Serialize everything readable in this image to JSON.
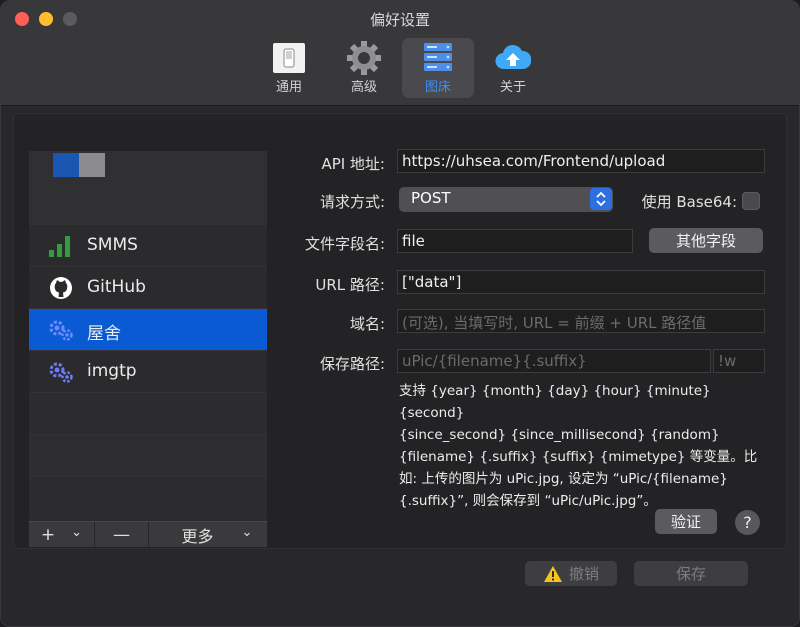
{
  "window": {
    "title": "偏好设置"
  },
  "toolbar": {
    "items": [
      {
        "label": "通用"
      },
      {
        "label": "高级"
      },
      {
        "label": "图床"
      },
      {
        "label": "关于"
      }
    ]
  },
  "hosts": {
    "items": [
      {
        "label": "SMMS"
      },
      {
        "label": "GitHub"
      },
      {
        "label": "屋舍"
      },
      {
        "label": "imgtp"
      }
    ],
    "actions": {
      "add": "+",
      "add_more": "⌄",
      "remove": "—",
      "more": "更多",
      "more_chev": "⌄"
    }
  },
  "form": {
    "api_label": "API 地址:",
    "api_value": "https://uhsea.com/Frontend/upload",
    "method_label": "请求方式:",
    "method_value": "POST",
    "base64_label": "使用 Base64:",
    "field_name_label": "文件字段名:",
    "field_name_value": "file",
    "other_fields_button": "其他字段",
    "url_path_label": "URL 路径:",
    "url_path_value": "[\"data\"]",
    "domain_label": "域名:",
    "domain_placeholder": "(可选), 当填写时, URL = 前缀 + URL 路径值",
    "save_path_label": "保存路径:",
    "save_path_placeholder": "uPic/{filename}{.suffix}",
    "suffix_placeholder": "!w",
    "hint_lines": [
      "支持 {year} {month} {day} {hour} {minute} {second}",
      "{since_second} {since_millisecond} {random}",
      "{filename} {.suffix} {suffix} {mimetype} 等变量。比",
      "如: 上传的图片为 uPic.jpg, 设定为 “uPic/{filename}",
      "{.suffix}”, 则会保存到 “uPic/uPic.jpg”。"
    ],
    "verify_button": "验证",
    "help_button": "?"
  },
  "footer": {
    "undo_button": "撤销",
    "save_button": "保存"
  },
  "colors": {
    "accent": "#0a5bd3",
    "active_label": "#3d8ef5"
  }
}
